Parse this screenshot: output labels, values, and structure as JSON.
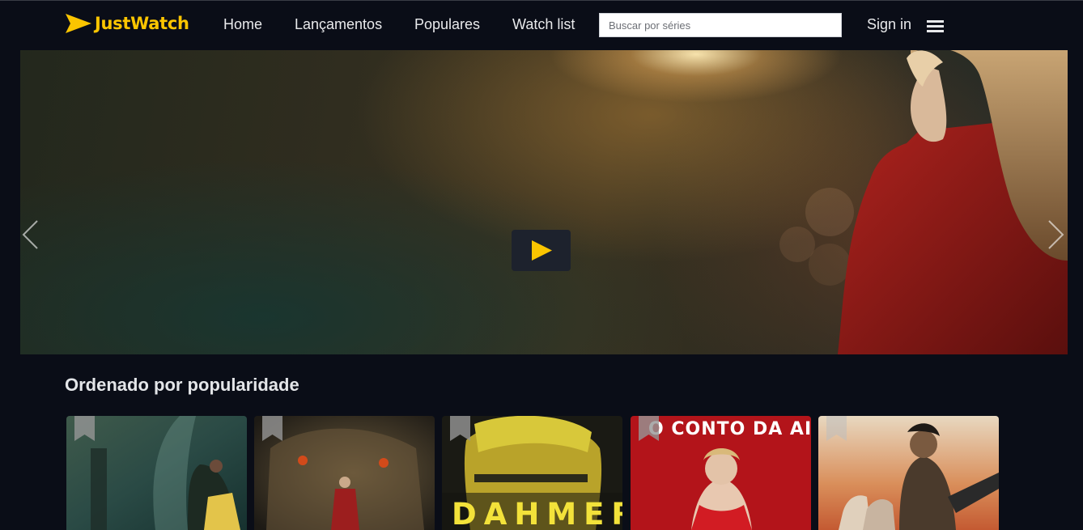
{
  "brand": {
    "name": "JustWatch",
    "accent": "#fbc500"
  },
  "nav": {
    "links": [
      "Home",
      "Lançamentos",
      "Populares",
      "Watch list"
    ],
    "search_placeholder": "Buscar por séries",
    "signin_label": "Sign in",
    "menu_icon": "hamburger-icon"
  },
  "hero": {
    "play_icon": "play-icon",
    "prev_icon": "chevron-left-icon",
    "next_icon": "chevron-right-icon"
  },
  "section": {
    "title": "Ordenado por popularidade"
  },
  "cards": [
    {
      "poster_text": ""
    },
    {
      "poster_text": ""
    },
    {
      "poster_text": "DAHMER"
    },
    {
      "poster_text": "O CONTO DA AIA"
    },
    {
      "poster_text": ""
    }
  ],
  "bookmark_icon": "bookmark-icon"
}
